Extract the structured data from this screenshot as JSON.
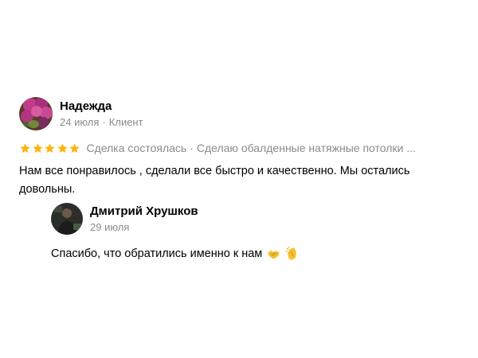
{
  "review": {
    "author": "Надежда",
    "date": "24 июля",
    "separator": "·",
    "role": "Клиент",
    "rating": 5,
    "rating_max": 5,
    "status": "Сделка состоялась",
    "service": "Сделаю обалденные натяжные потолки ...",
    "text": "Нам все понравилось , сделали все быстро и качественно. Мы остались довольны.",
    "star_color": "#fbb40f"
  },
  "reply": {
    "author": "Дмитрий Хрушков",
    "date": "29 июля",
    "text": "Спасибо, что обратились именно к нам",
    "emojis": [
      "handshake-emoji",
      "clapping-hands-emoji"
    ]
  }
}
